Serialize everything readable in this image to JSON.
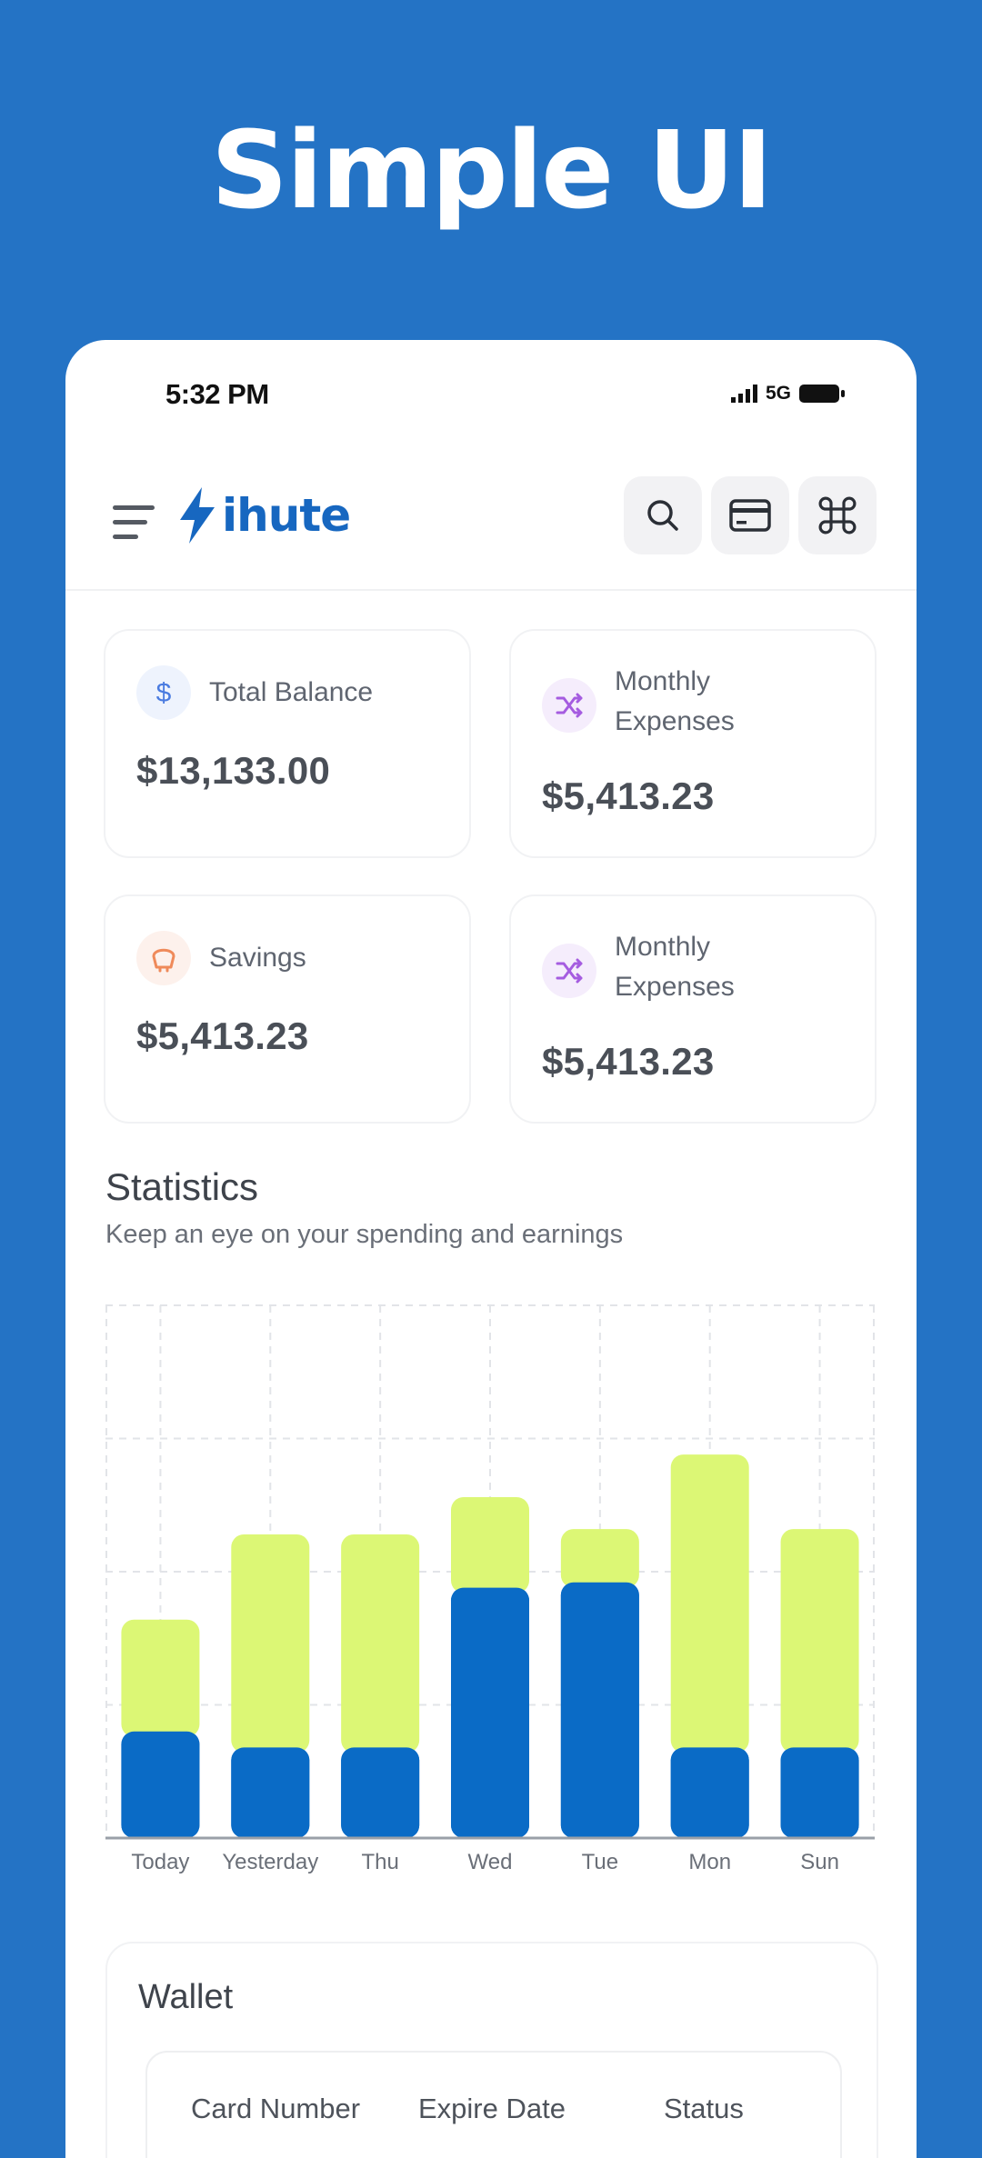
{
  "promo": {
    "title": "Simple UI"
  },
  "status_bar": {
    "time": "5:32 PM",
    "network": "5G"
  },
  "header": {
    "logo_text": "ihute",
    "icons": {
      "menu": "menu-icon",
      "logo": "bolt-icon",
      "search": "search-icon",
      "card": "credit-card-icon",
      "command": "command-icon"
    }
  },
  "summary_cards": [
    {
      "label": "Total Balance",
      "value": "$13,133.00",
      "icon": "dollar-icon",
      "icon_color": "#4a7be0",
      "icon_bg": "#eef3fd"
    },
    {
      "label": "Monthly Expenses",
      "value": "$5,413.23",
      "icon": "shuffle-icon",
      "icon_color": "#a55ce0",
      "icon_bg": "#f5edfc"
    },
    {
      "label": "Savings",
      "value": "$5,413.23",
      "icon": "savings-icon",
      "icon_color": "#ef8a5a",
      "icon_bg": "#fdf1ec"
    },
    {
      "label": "Monthly Expenses",
      "value": "$5,413.23",
      "icon": "shuffle-icon",
      "icon_color": "#a55ce0",
      "icon_bg": "#f5edfc"
    }
  ],
  "statistics": {
    "title": "Statistics",
    "subtitle": "Keep an eye on your spending and earnings"
  },
  "chart_data": {
    "type": "bar",
    "stacked": true,
    "categories": [
      "Today",
      "Yesterday",
      "Thu",
      "Wed",
      "Tue",
      "Mon",
      "Sun"
    ],
    "series": [
      {
        "values": [
          2.0,
          1.7,
          1.7,
          4.7,
          4.8,
          1.7,
          1.7
        ],
        "color": "#0a6bc6"
      },
      {
        "values": [
          2.1,
          4.0,
          4.0,
          1.7,
          1.0,
          5.5,
          4.1
        ],
        "color": "#dcf775"
      }
    ],
    "ylim": [
      0,
      10
    ],
    "grid": true,
    "legend": "none"
  },
  "wallet": {
    "title": "Wallet",
    "columns": [
      "Card Number",
      "Expire Date",
      "Status"
    ]
  }
}
